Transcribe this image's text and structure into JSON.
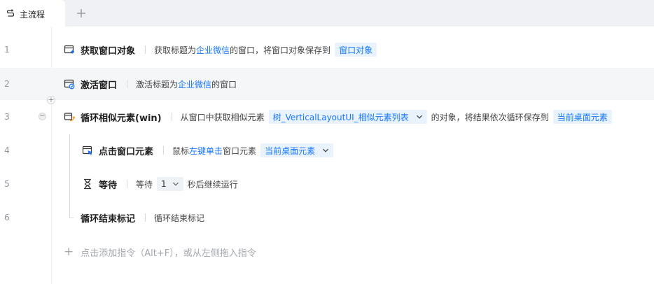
{
  "tab": {
    "icon": "flow-icon",
    "label": "主流程",
    "add_icon": "plus-icon"
  },
  "rows": [
    {
      "no": "1",
      "icon": "get-window-icon",
      "title": "获取窗口对象",
      "desc_a": "获取标题为",
      "link": "企业微信",
      "desc_b": "的窗口，将窗口对象保存到",
      "var": "窗口对象"
    },
    {
      "no": "2",
      "icon": "activate-window-icon",
      "title": "激活窗口",
      "desc_a": "激活标题为",
      "link": "企业微信",
      "desc_b": "的窗口"
    },
    {
      "no": "3",
      "icon": "loop-icon",
      "title": "循环相似元素(win)",
      "desc_a": "从窗口中获取相似元素",
      "select": "树_VerticalLayoutUI_相似元素列表",
      "desc_b": "的对象，将结果依次循环保存到",
      "var": "当前桌面元素"
    },
    {
      "no": "4",
      "icon": "click-element-icon",
      "title": "点击窗口元素",
      "desc_a": "鼠标",
      "link": "左键单击",
      "desc_b": "窗口元素",
      "select": "当前桌面元素"
    },
    {
      "no": "5",
      "icon": "hourglass-icon",
      "title": "等待",
      "desc_a": "等待",
      "select": "1",
      "desc_b": "秒后继续运行"
    },
    {
      "no": "6",
      "title": "循环结束标记",
      "desc_a": "循环结束标记"
    }
  ],
  "add_command": "点击添加指令（Alt+F），或从左侧拖入指令"
}
